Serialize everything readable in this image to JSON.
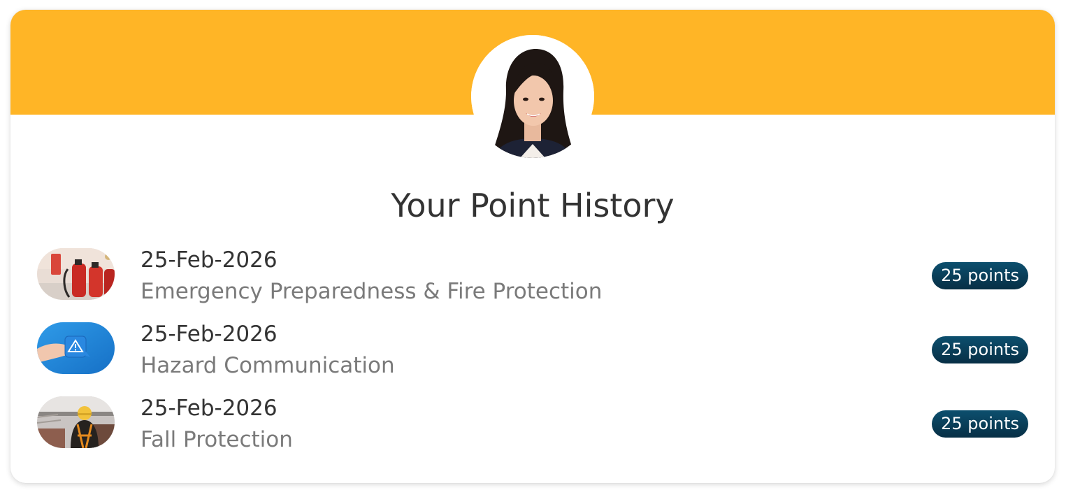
{
  "profile": {
    "avatar_icon": "user-photo"
  },
  "header": {
    "title": "Your Point History",
    "banner_color": "#ffb526"
  },
  "history": [
    {
      "date": "25-Feb-2026",
      "course": "Emergency Preparedness & Fire Protection",
      "points": "25 points",
      "thumbnail_icon": "fire-extinguisher-photo"
    },
    {
      "date": "25-Feb-2026",
      "course": "Hazard Communication",
      "points": "25 points",
      "thumbnail_icon": "hazard-warning-photo"
    },
    {
      "date": "25-Feb-2026",
      "course": "Fall Protection",
      "points": "25 points",
      "thumbnail_icon": "worker-harness-photo"
    }
  ],
  "colors": {
    "badge": "#0a3f5a",
    "date_text": "#333333",
    "course_text": "#7a7a7a"
  }
}
